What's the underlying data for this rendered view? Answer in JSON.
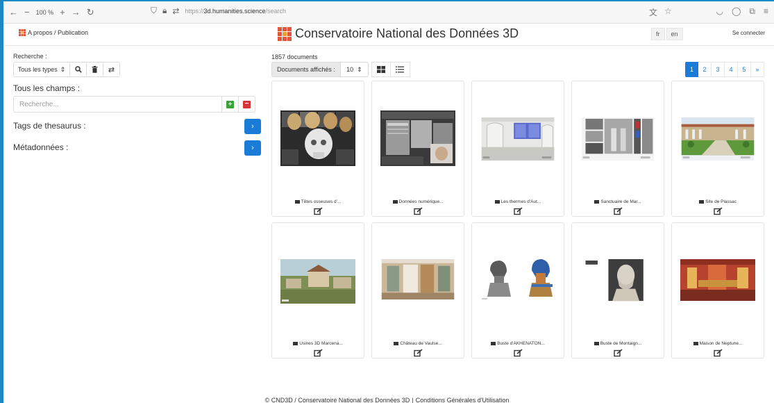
{
  "browser": {
    "zoom": "100 %",
    "url_prefix": "https://",
    "url_host": "3d.humanities.science",
    "url_path": "/search"
  },
  "header": {
    "about_link": "A propos / Publication",
    "title": "Conservatoire National des Données 3D",
    "lang_fr": "fr",
    "lang_en": "en",
    "login": "Se connecter",
    "logo_color": "#e2563b"
  },
  "sidebar": {
    "search_label": "Recherche :",
    "type_select": "Tous les types",
    "all_fields_label": "Tous les champs :",
    "search_placeholder": "Recherche...",
    "thesaurus_label": "Tags de thesaurus :",
    "metadata_label": "Métadonnées :"
  },
  "main": {
    "doc_count": "1857 documents",
    "displayed_label": "Documents affichés :",
    "per_page": "10",
    "pages": [
      "1",
      "2",
      "3",
      "4",
      "5",
      "»"
    ],
    "accent": "#1a7cd6"
  },
  "cards": [
    {
      "title": "Têtes osseuses d'...",
      "thumb": "skulls"
    },
    {
      "title": "Données numérique...",
      "thumb": "docs"
    },
    {
      "title": "Les thermes d'Aut...",
      "thumb": "thermes"
    },
    {
      "title": "Sanctuaire de Mar...",
      "thumb": "sanctuaire"
    },
    {
      "title": "Site de Plassac",
      "thumb": "plassac"
    },
    {
      "title": "Usines 3D Marcena...",
      "thumb": "usines"
    },
    {
      "title": "Château de Vaulse...",
      "thumb": "chateau"
    },
    {
      "title": "Buste d'AKHENATON...",
      "thumb": "akhenaton"
    },
    {
      "title": "Buste de Montaign...",
      "thumb": "montaigne"
    },
    {
      "title": "Maison de Neptune...",
      "thumb": "neptune"
    }
  ],
  "footer": {
    "copyright": "© CND3D / Conservatoire National des Données 3D",
    "cgu": "Conditions Générales d'Utilisation"
  }
}
